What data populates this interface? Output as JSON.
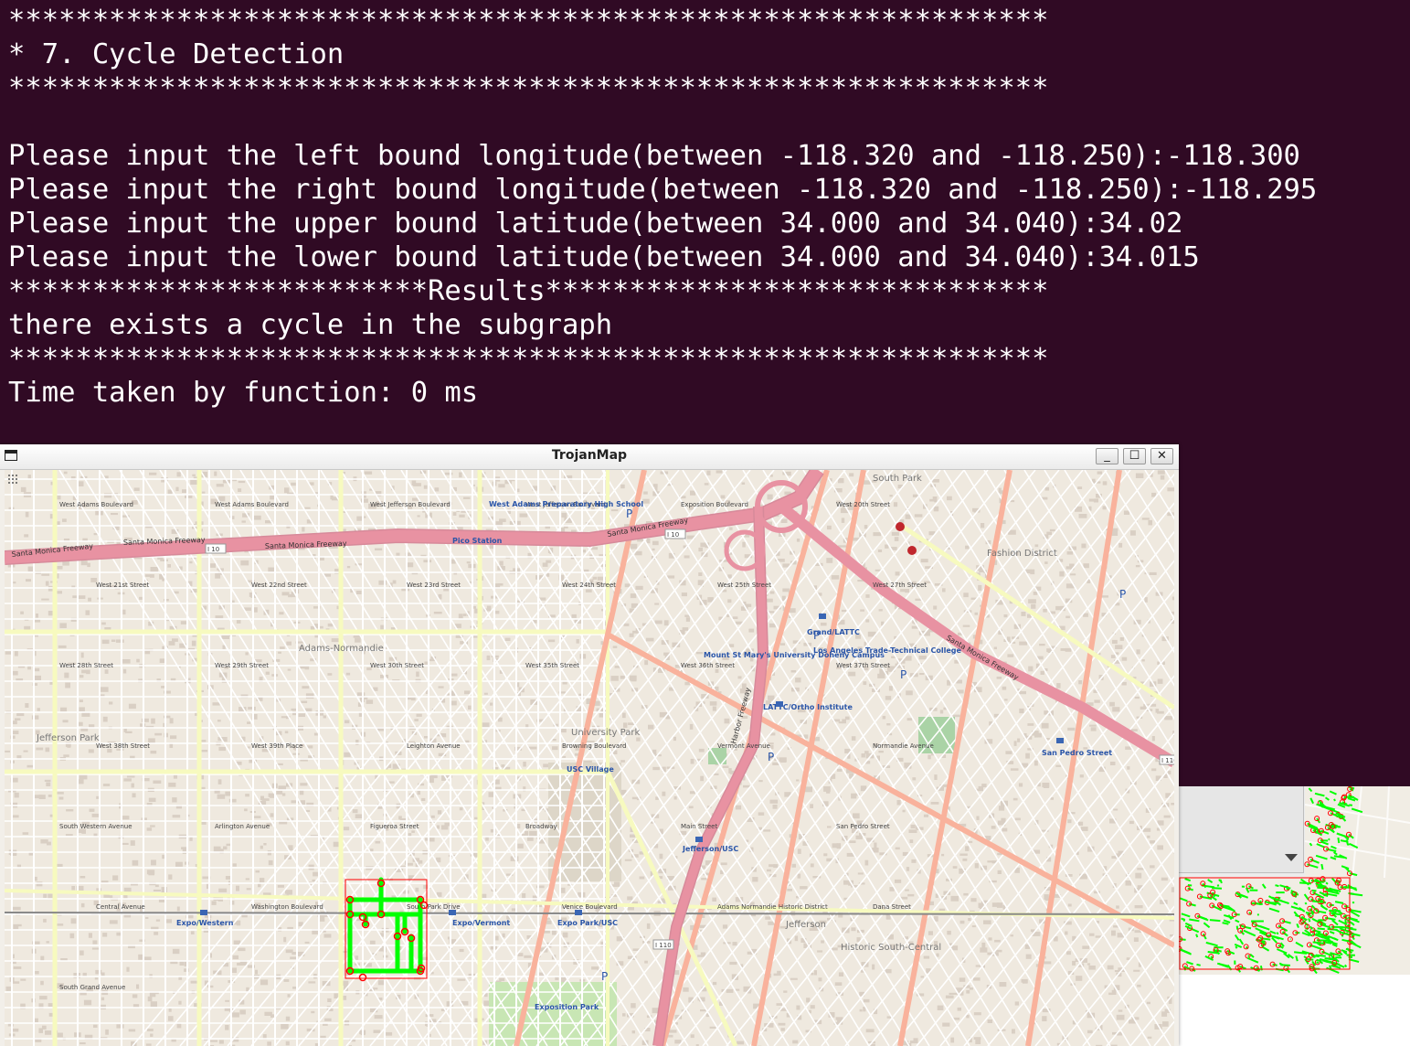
{
  "terminal": {
    "lines": [
      "**************************************************************",
      "* 7. Cycle Detection",
      "**************************************************************",
      "",
      "Please input the left bound longitude(between -118.320 and -118.250):-118.300",
      "Please input the right bound longitude(between -118.320 and -118.250):-118.295",
      "Please input the upper bound latitude(between 34.000 and 34.040):34.02",
      "Please input the lower bound latitude(between 34.000 and 34.040):34.015",
      "*************************Results******************************",
      "there exists a cycle in the subgraph",
      "**************************************************************",
      "Time taken by function: 0 ms"
    ]
  },
  "window": {
    "title": "TrojanMap",
    "minimize_label": "_",
    "maximize_label": "☐",
    "close_label": "✕"
  },
  "colors": {
    "terminal_bg": "#300a24",
    "terminal_fg": "#ffffff",
    "freeway": "#e892a2",
    "primary_road": "#f9b29c",
    "secondary_road": "#f7fabf",
    "path": "#00ff00",
    "node": "#ff0000",
    "bbox": "#ff0000"
  },
  "map": {
    "freeway_labels": [
      "Santa Monica Freeway",
      "Santa Monica Freeway",
      "Santa Monica Freeway",
      "Santa Monica Freeway",
      "Santa Monica Freeway",
      "Harbor Freeway"
    ],
    "freeway_shields": [
      "I 10",
      "I 10",
      "I 110",
      "I 110",
      "I 10"
    ],
    "area_labels": [
      "Adams-Normandie",
      "University Park",
      "Jefferson",
      "Historic South-Central",
      "Jefferson Park",
      "Fashion District",
      "South Park"
    ],
    "road_labels": [
      "West Adams Boulevard",
      "West Adams Boulevard",
      "West Jefferson Boulevard",
      "West Jefferson Boulevard",
      "Exposition Boulevard",
      "West 20th Street",
      "West 21st Street",
      "West 22nd Street",
      "West 23rd Street",
      "West 24th Street",
      "West 25th Street",
      "West 27th Street",
      "West 28th Street",
      "West 29th Street",
      "West 30th Street",
      "West 35th Street",
      "West 36th Street",
      "West 37th Street",
      "West 38th Street",
      "West 39th Place",
      "Leighton Avenue",
      "Browning Boulevard",
      "Vermont Avenue",
      "Normandie Avenue",
      "South Western Avenue",
      "Arlington Avenue",
      "Figueroa Street",
      "Broadway",
      "Main Street",
      "San Pedro Street",
      "Central Avenue",
      "Washington Boulevard",
      "South Park Drive",
      "Venice Boulevard",
      "Adams Normandie Historic District",
      "Dana Street",
      "South Grand Avenue"
    ],
    "poi_labels": [
      "Expo/Western",
      "Expo/Vermont",
      "Expo Park/USC",
      "Jefferson/USC",
      "LATTC/Ortho Institute",
      "Grand/LATTC",
      "San Pedro Street",
      "Pico Station",
      "Exposition Park",
      "Mount St Mary's University Doheny Campus",
      "Los Angeles Trade-Technical College",
      "USC Village",
      "West Adams Preparatory High School"
    ],
    "selection_bounds": {
      "left": -118.3,
      "right": -118.295,
      "upper": 34.02,
      "lower": 34.015
    }
  }
}
